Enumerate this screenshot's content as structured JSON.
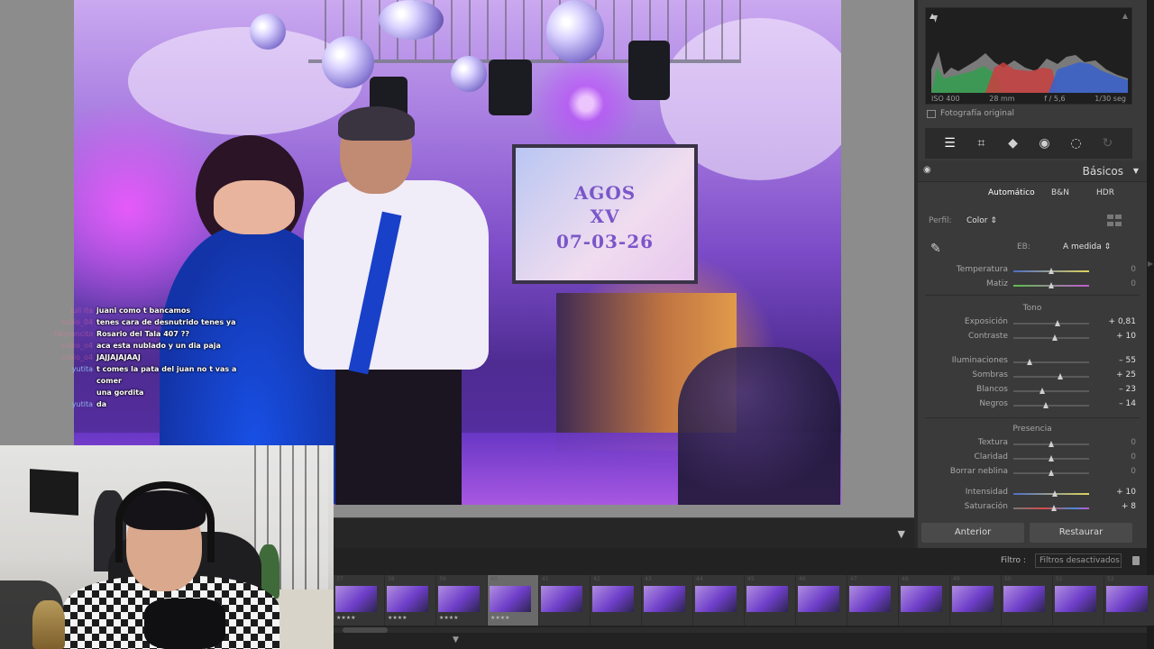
{
  "photo": {
    "screen_line1": "AGOS",
    "screen_line2": "XV",
    "screen_line3": "07-03-26"
  },
  "chat": [
    {
      "user": "juli ita",
      "message": "juani como t bancamos"
    },
    {
      "user": "rubio_04",
      "message": "tenes cara de desnutrido tenes ya"
    },
    {
      "user": "tiburoncito",
      "message": "Rosario del Tala 407 ??"
    },
    {
      "user": "rubio_o4",
      "message": "aca esta nublado y un dia paja"
    },
    {
      "user": "rubio_o4",
      "message": "JAJJAJAJAAJ"
    },
    {
      "user": "yutita",
      "message": "t comes la pata del juan no t vas a comer"
    },
    {
      "user": "",
      "message": "una gordita"
    },
    {
      "user": "yutita",
      "message": "da"
    }
  ],
  "histogram": {
    "iso": "ISO 400",
    "focal": "28 mm",
    "aperture": "f / 5,6",
    "shutter": "1/30 seg",
    "original_label": "Fotografía original"
  },
  "tools": [
    "sliders-icon",
    "crop-icon",
    "eraser-icon",
    "redeye-icon",
    "mask-icon",
    "preset-icon"
  ],
  "basics": {
    "title": "Básicos",
    "treatments": [
      "Automático",
      "B&N",
      "HDR"
    ],
    "profile_label": "Perfil:",
    "profile_value": "Color",
    "eb_label": "EB:",
    "eb_value": "A medida",
    "sections": {
      "tono": "Tono",
      "presencia": "Presencia"
    },
    "wb": [
      {
        "label": "Temperatura",
        "value": "0",
        "pos": 0.5
      },
      {
        "label": "Matiz",
        "value": "0",
        "pos": 0.5
      }
    ],
    "tone": [
      {
        "label": "Exposición",
        "value": "+ 0,81",
        "pos": 0.58
      },
      {
        "label": "Contraste",
        "value": "+ 10",
        "pos": 0.55
      }
    ],
    "tone2": [
      {
        "label": "Iluminaciones",
        "value": "– 55",
        "pos": 0.22
      },
      {
        "label": "Sombras",
        "value": "+ 25",
        "pos": 0.62
      },
      {
        "label": "Blancos",
        "value": "– 23",
        "pos": 0.38
      },
      {
        "label": "Negros",
        "value": "– 14",
        "pos": 0.43
      }
    ],
    "presence": [
      {
        "label": "Textura",
        "value": "0",
        "pos": 0.5
      },
      {
        "label": "Claridad",
        "value": "0",
        "pos": 0.5
      },
      {
        "label": "Borrar neblina",
        "value": "0",
        "pos": 0.5
      }
    ],
    "presence2": [
      {
        "label": "Intensidad",
        "value": "+ 10",
        "pos": 0.55
      },
      {
        "label": "Saturación",
        "value": "+ 8",
        "pos": 0.54
      }
    ]
  },
  "buttons": {
    "previous": "Anterior",
    "reset": "Restaurar"
  },
  "filmstrip": {
    "filter_label": "Filtro :",
    "filter_value": "Filtros desactivados",
    "thumbs": [
      {
        "num": "37",
        "stars": "★★★★"
      },
      {
        "num": "38",
        "stars": "★★★★"
      },
      {
        "num": "39",
        "stars": "★★★★"
      },
      {
        "num": "40",
        "stars": "★★★★",
        "active": true
      },
      {
        "num": "41",
        "stars": ""
      },
      {
        "num": "42",
        "stars": ""
      },
      {
        "num": "43",
        "stars": ""
      },
      {
        "num": "44",
        "stars": ""
      },
      {
        "num": "45",
        "stars": ""
      },
      {
        "num": "46",
        "stars": ""
      },
      {
        "num": "47",
        "stars": ""
      },
      {
        "num": "48",
        "stars": ""
      },
      {
        "num": "49",
        "stars": ""
      },
      {
        "num": "50",
        "stars": ""
      },
      {
        "num": "51",
        "stars": ""
      },
      {
        "num": "52",
        "stars": ""
      }
    ]
  }
}
